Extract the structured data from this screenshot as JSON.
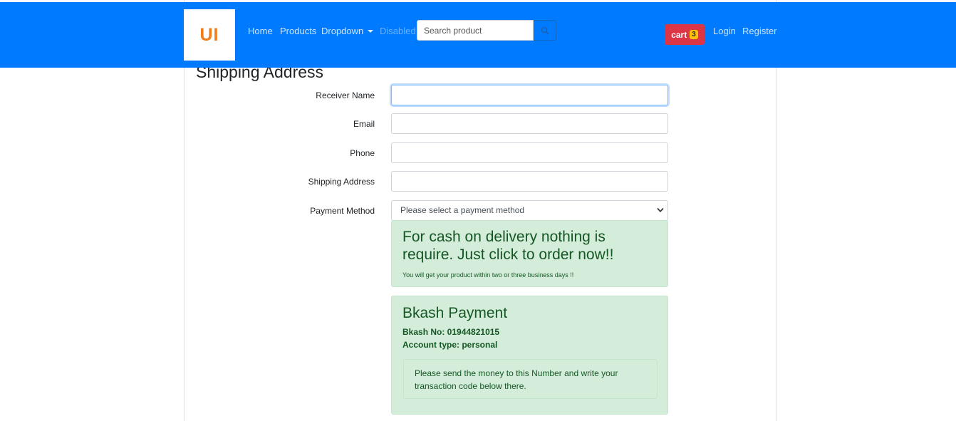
{
  "navbar": {
    "logo_text": "UI",
    "links": {
      "home": "Home",
      "products": "Products",
      "dropdown": "Dropdown",
      "disabled": "Disabled"
    },
    "search": {
      "placeholder": "Search product"
    },
    "cart": {
      "label": "cart",
      "count": "3"
    },
    "login": "Login",
    "register": "Register",
    "colors": {
      "navbar_bg": "#007bff",
      "cart_bg": "#dc3545",
      "badge_bg": "#ffc107",
      "logo_text": "#f07c1a"
    }
  },
  "page": {
    "heading": "Shipping Address"
  },
  "form": {
    "receiver_name_label": "Receiver Name",
    "receiver_name_value": "",
    "email_label": "Email",
    "email_value": "",
    "phone_label": "Phone",
    "phone_value": "",
    "shipping_address_label": "Shipping Address",
    "shipping_address_value": "",
    "payment_method_label": "Payment Method",
    "payment_method_selected": "Please select a payment method"
  },
  "cod_alert": {
    "title": "For cash on delivery nothing is require. Just click to order now!!",
    "note": "You will get your product within two or three business days !!"
  },
  "bkash_alert": {
    "title": "Bkash Payment",
    "number_line": "Bkash No: 01944821015",
    "account_line": "Account type: personal",
    "instruction": "Please send the money to this Number and write your transaction code below there.",
    "colors": {
      "bg": "#d4edda",
      "text": "#155724"
    }
  }
}
